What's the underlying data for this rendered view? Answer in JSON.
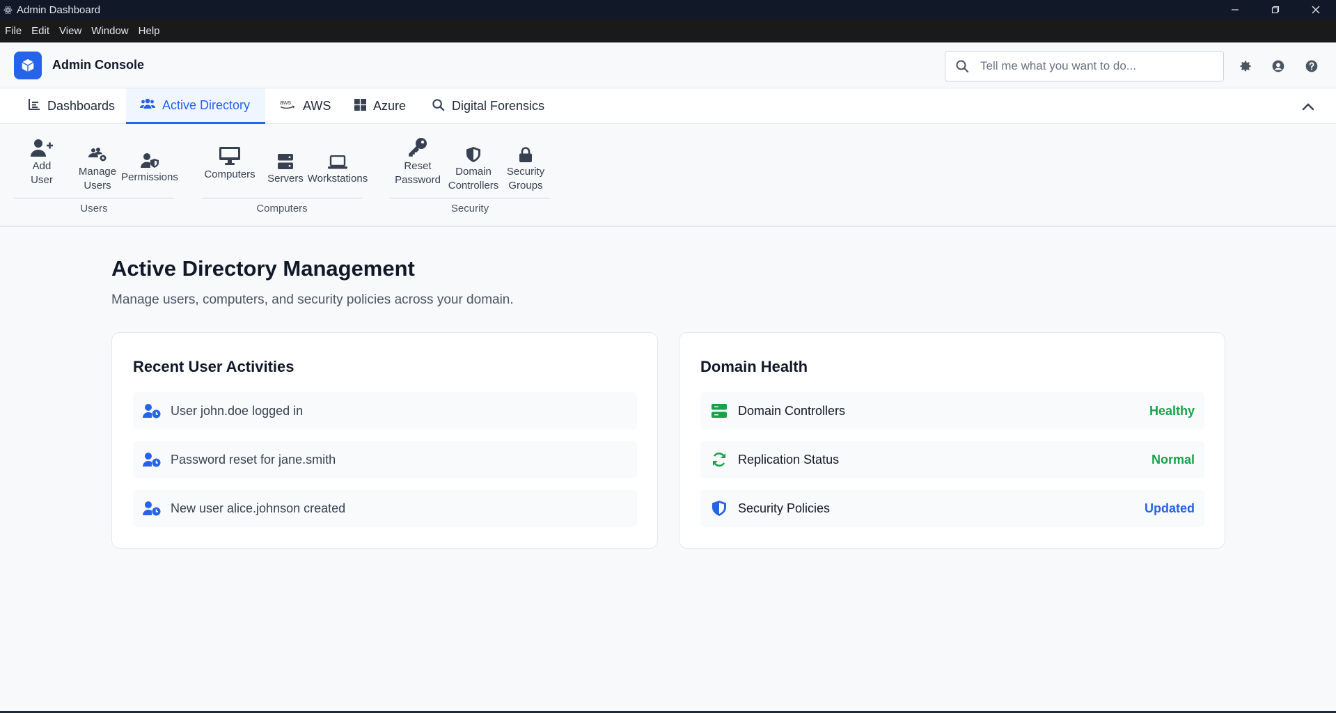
{
  "window": {
    "title": "Admin Dashboard"
  },
  "menu": [
    "File",
    "Edit",
    "View",
    "Window",
    "Help"
  ],
  "header": {
    "brand": "Admin Console",
    "search_placeholder": "Tell me what you want to do..."
  },
  "tabs": [
    {
      "label": "Dashboards",
      "icon": "chart-line-icon"
    },
    {
      "label": "Active Directory",
      "icon": "users-icon",
      "active": true
    },
    {
      "label": "AWS",
      "icon": "aws-icon"
    },
    {
      "label": "Azure",
      "icon": "windows-icon"
    },
    {
      "label": "Digital Forensics",
      "icon": "search-icon"
    }
  ],
  "ribbon": {
    "groups": [
      {
        "label": "Users",
        "items": [
          {
            "label": "Add User",
            "icon": "user-plus-icon"
          },
          {
            "label": "Manage Users",
            "icon": "users-cog-icon"
          },
          {
            "label": "Permissions",
            "icon": "user-shield-icon"
          }
        ]
      },
      {
        "label": "Computers",
        "items": [
          {
            "label": "Computers",
            "icon": "desktop-icon"
          },
          {
            "label": "Servers",
            "icon": "server-icon"
          },
          {
            "label": "Workstations",
            "icon": "laptop-icon"
          }
        ]
      },
      {
        "label": "Security",
        "items": [
          {
            "label": "Reset Password",
            "icon": "key-icon"
          },
          {
            "label": "Domain Controllers",
            "icon": "shield-icon"
          },
          {
            "label": "Security Groups",
            "icon": "lock-icon"
          }
        ]
      }
    ]
  },
  "main": {
    "title": "Active Directory Management",
    "subtitle": "Manage users, computers, and security policies across your domain.",
    "activities": {
      "title": "Recent User Activities",
      "items": [
        "User john.doe logged in",
        "Password reset for jane.smith",
        "New user alice.johnson created"
      ]
    },
    "health": {
      "title": "Domain Health",
      "items": [
        {
          "label": "Domain Controllers",
          "status": "Healthy",
          "icon": "server-icon",
          "color": "#16a34a"
        },
        {
          "label": "Replication Status",
          "status": "Normal",
          "icon": "sync-icon",
          "color": "#16a34a"
        },
        {
          "label": "Security Policies",
          "status": "Updated",
          "icon": "shield-icon",
          "color": "#2563eb"
        }
      ]
    }
  },
  "colors": {
    "accent": "#2563eb",
    "success": "#16a34a"
  }
}
